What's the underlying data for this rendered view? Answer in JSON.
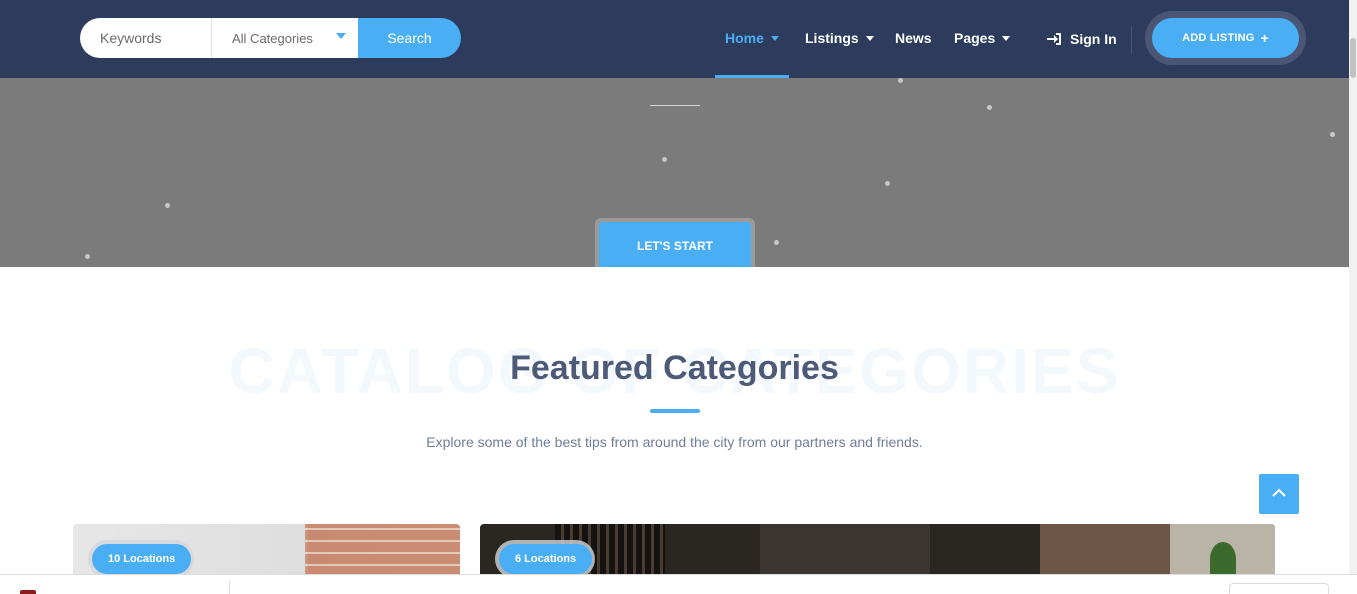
{
  "header": {
    "search": {
      "keywords_placeholder": "Keywords",
      "category_selected": "All Categories",
      "search_label": "Search"
    },
    "nav": [
      {
        "label": "Home",
        "has_dropdown": true,
        "active": true
      },
      {
        "label": "Listings",
        "has_dropdown": true,
        "active": false
      },
      {
        "label": "News",
        "has_dropdown": false,
        "active": false
      },
      {
        "label": "Pages",
        "has_dropdown": true,
        "active": false
      }
    ],
    "sign_in_label": "Sign In",
    "add_listing_label": "ADD LISTING",
    "add_listing_icon": "plus-icon"
  },
  "hero": {
    "cta_label": "LET'S START"
  },
  "featured": {
    "background_text": "CATALOG OF CATEGORIES",
    "title": "Featured Categories",
    "subtitle": "Explore some of the best tips from around the city from our partners and friends."
  },
  "categories": [
    {
      "locations_label": "10 Locations"
    },
    {
      "locations_label": "6 Locations"
    }
  ],
  "scroll_to_top_icon": "chevron-up-icon",
  "colors": {
    "header_bg": "#2d3b5c",
    "accent": "#4aaef5",
    "hero_overlay": "#7b7b7b",
    "title_text": "#4d5b78"
  }
}
